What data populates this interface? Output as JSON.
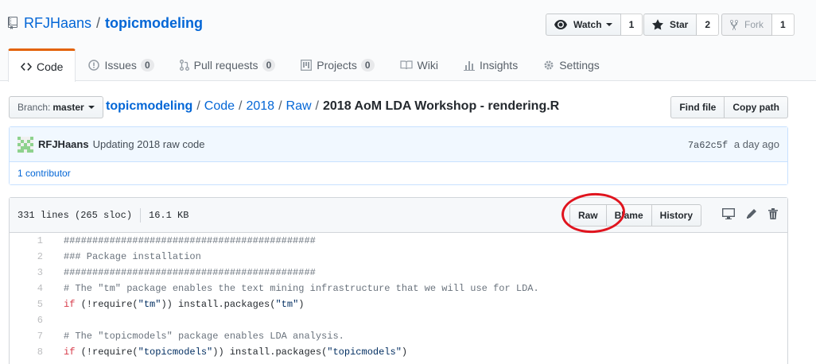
{
  "repo": {
    "owner": "RFJHaans",
    "separator": "/",
    "name": "topicmodeling"
  },
  "actions": {
    "watch": {
      "label": "Watch",
      "count": "1"
    },
    "star": {
      "label": "Star",
      "count": "2"
    },
    "fork": {
      "label": "Fork",
      "count": "1"
    }
  },
  "tabs": [
    {
      "label": "Code",
      "icon": "code-icon"
    },
    {
      "label": "Issues",
      "count": "0",
      "icon": "issue-icon"
    },
    {
      "label": "Pull requests",
      "count": "0",
      "icon": "pull-request-icon"
    },
    {
      "label": "Projects",
      "count": "0",
      "icon": "project-icon"
    },
    {
      "label": "Wiki",
      "icon": "book-icon"
    },
    {
      "label": "Insights",
      "icon": "graph-icon"
    },
    {
      "label": "Settings",
      "icon": "gear-icon"
    }
  ],
  "file_nav": {
    "branch_label": "Branch:",
    "branch_value": "master",
    "breadcrumb": [
      "topicmodeling",
      "Code",
      "2018",
      "Raw"
    ],
    "file_name": "2018 AoM LDA Workshop - rendering.R",
    "find_file": "Find file",
    "copy_path": "Copy path"
  },
  "commit": {
    "author": "RFJHaans",
    "message": "Updating 2018 raw code",
    "sha": "7a62c5f",
    "time": "a day ago",
    "contributors": "1 contributor"
  },
  "file": {
    "lines": "331 lines (265 sloc)",
    "size": "16.1 KB",
    "raw": "Raw",
    "blame": "Blame",
    "history": "History"
  },
  "code_lines": [
    {
      "n": "1",
      "text": "############################################"
    },
    {
      "n": "2",
      "text": "### Package installation"
    },
    {
      "n": "3",
      "text": "############################################"
    },
    {
      "n": "4",
      "text": "# The \"tm\" package enables the text mining infrastructure that we will use for LDA."
    },
    {
      "n": "5",
      "kw": "if",
      "pre": " (!require(",
      "str": "\"tm\"",
      "mid": ")) install.packages(",
      "str2": "\"tm\"",
      "post": ")"
    },
    {
      "n": "6",
      "text": ""
    },
    {
      "n": "7",
      "text": "# The \"topicmodels\" package enables LDA analysis."
    },
    {
      "n": "8",
      "kw": "if",
      "pre": " (!require(",
      "str": "\"topicmodels\"",
      "mid": ")) install.packages(",
      "str2": "\"topicmodels\"",
      "post": ")"
    }
  ],
  "colors": {
    "link": "#0366d6",
    "tab_accent": "#e36209",
    "annotation": "#e0141e"
  }
}
